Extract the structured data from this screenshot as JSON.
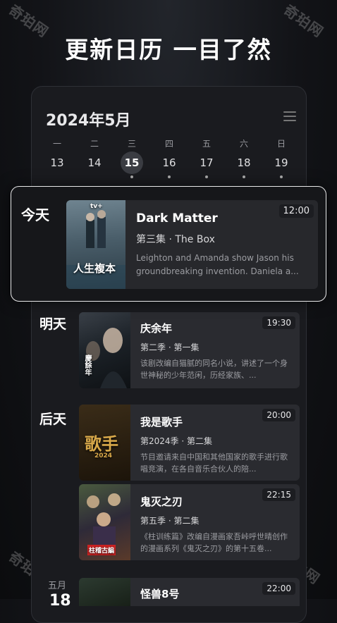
{
  "watermark": "奇珀网",
  "headline": "更新日历 一目了然",
  "calendar": {
    "month_title": "2024年5月",
    "weekdays": [
      "一",
      "二",
      "三",
      "四",
      "五",
      "六",
      "日"
    ],
    "dates": [
      "13",
      "14",
      "15",
      "16",
      "17",
      "18",
      "19"
    ],
    "selected_date": "15"
  },
  "today": {
    "day_label": "今天",
    "title": "Dark Matter",
    "episode": "第三集 · The Box",
    "desc": "Leighton and Amanda show Jason his groundbreaking invention. Daniela a...",
    "time": "12:00",
    "poster_text": "人生複本",
    "badge": "tv+"
  },
  "tomorrow": {
    "day_label": "明天",
    "title": "庆余年",
    "episode": "第二季 · 第一集",
    "desc": "该剧改编自猫腻的同名小说，讲述了一个身世神秘的少年范闲，历经家族、...",
    "time": "19:30",
    "poster_text": "慶餘年"
  },
  "day_after": {
    "day_label": "后天",
    "shows": [
      {
        "title": "我是歌手",
        "episode": "第2024季 · 第二集",
        "desc": "节目邀请来自中国和其他国家的歌手进行歌唱竞演，在各自音乐合伙人的陪...",
        "time": "20:00",
        "poster_text": "歌手",
        "poster_sub": "2024"
      },
      {
        "title": "鬼灭之刃",
        "episode": "第五季 · 第二集",
        "desc": "《柱训练篇》改编自漫画家吾峠呼世晴创作的漫画系列《鬼灭之刃》的第十五卷...",
        "time": "22:15",
        "poster_text": "柱稽古編"
      }
    ]
  },
  "later": {
    "month": "五月",
    "date": "18",
    "title": "怪兽8号",
    "time": "22:00"
  }
}
